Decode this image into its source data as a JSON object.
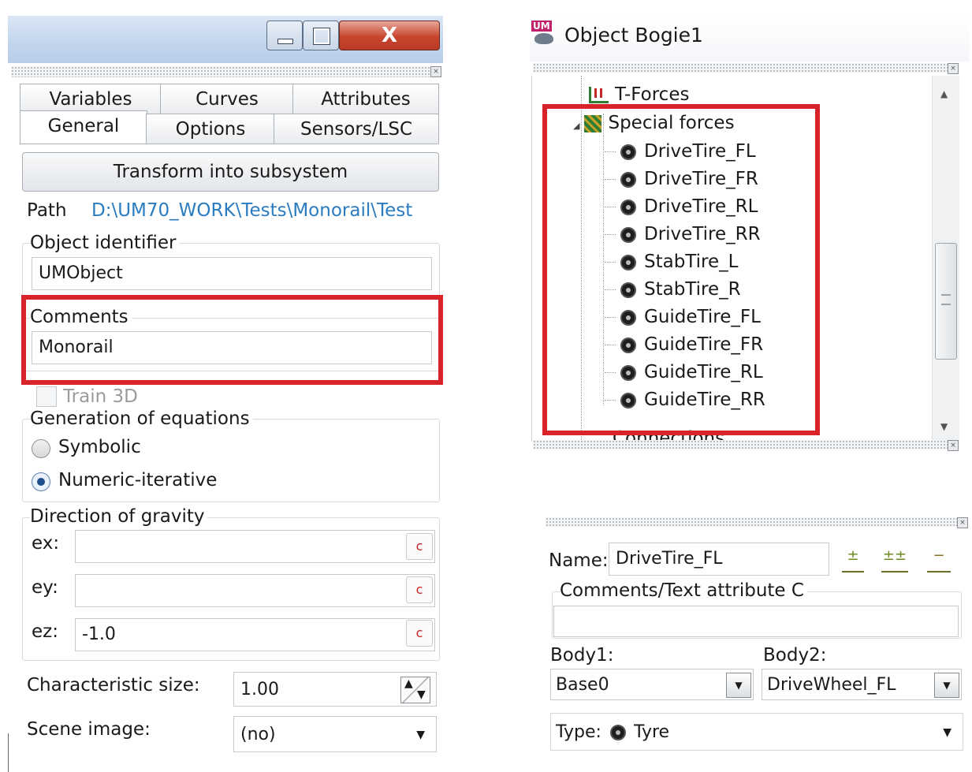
{
  "window": {
    "controls": [
      "minimize-icon",
      "restore-icon",
      "close-icon"
    ],
    "close_glyph": "X"
  },
  "left": {
    "tabs_top": [
      "Variables",
      "Curves",
      "Attributes"
    ],
    "tabs_bottom": [
      "General",
      "Options",
      "Sensors/LSC"
    ],
    "transform_button": "Transform into subsystem",
    "path_label": "Path",
    "path_value": "D:\\UM70_WORK\\Tests\\Monorail\\Test",
    "object_identifier_label": "Object identifier",
    "object_identifier_value": "UMObject",
    "comments_label": "Comments",
    "comments_value": "Monorail",
    "train3d_label": "Train 3D",
    "generation_label": "Generation of equations",
    "symbolic_label": "Symbolic",
    "numeric_label": "Numeric-iterative",
    "gravity_label": "Direction of gravity",
    "ex_label": "ex:",
    "ex_value": "",
    "ey_label": "ey:",
    "ey_value": "",
    "ez_label": "ez:",
    "ez_value": "-1.0",
    "c_button": "c",
    "char_size_label": "Characteristic size:",
    "char_size_value": "1.00",
    "scene_image_label": "Scene image:",
    "scene_image_value": "(no)"
  },
  "tree": {
    "title": "Object Bogie1",
    "app_icon_text": "UM",
    "t_forces": "T-Forces",
    "special_forces": "Special forces",
    "children": [
      "DriveTire_FL",
      "DriveTire_FR",
      "DriveTire_RL",
      "DriveTire_RR",
      "StabTire_L",
      "StabTire_R",
      "GuideTire_FL",
      "GuideTire_FR",
      "GuideTire_RL",
      "GuideTire_RR"
    ],
    "connections": "Connections"
  },
  "props": {
    "name_label": "Name:",
    "name_value": "DriveTire_FL",
    "comments_label": "Comments/Text attribute C",
    "comments_value": "",
    "body1_label": "Body1:",
    "body1_value": "Base0",
    "body2_label": "Body2:",
    "body2_value": "DriveWheel_FL",
    "type_label": "Type:",
    "type_value": "Tyre"
  },
  "colors": {
    "highlight": "#d8232a",
    "path_link": "#2a7bc0"
  }
}
